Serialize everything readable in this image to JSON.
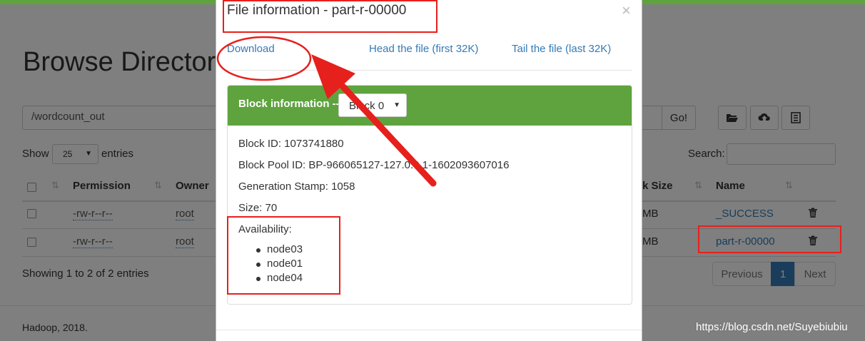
{
  "page": {
    "title": "Browse Director",
    "path_value": "/wordcount_out",
    "go_label": "Go!",
    "show_label": "Show",
    "page_size": "25",
    "entries_label": "entries",
    "search_label": "Search:",
    "columns": [
      "Permission",
      "Owner",
      "k Size",
      "Name"
    ],
    "rows": [
      {
        "permission": "-rw-r--r--",
        "owner": "root",
        "size": "MB",
        "name": "_SUCCESS"
      },
      {
        "permission": "-rw-r--r--",
        "owner": "root",
        "size": "MB",
        "name": "part-r-00000"
      }
    ],
    "showing_text": "Showing 1 to 2 of 2 entries",
    "pagination": {
      "previous": "Previous",
      "current": "1",
      "next": "Next"
    },
    "footer": "Hadoop, 2018.",
    "watermark": "https://blog.csdn.net/Suyebiubiu"
  },
  "modal": {
    "title": "File information - part-r-00000",
    "close": "×",
    "links": {
      "download": "Download",
      "head": "Head the file (first 32K)",
      "tail": "Tail the file (last 32K)"
    },
    "panel": {
      "heading": "Block information --",
      "block_select": "Block 0",
      "block_id": "Block ID: 1073741880",
      "block_pool_id": "Block Pool ID: BP-966065127-127.0.0.1-1602093607016",
      "generation_stamp": "Generation Stamp: 1058",
      "size": "Size: 70",
      "availability_label": "Availability:",
      "availability": [
        "node03",
        "node01",
        "node04"
      ]
    }
  },
  "icons": [
    "folder-open-icon",
    "cloud-upload-icon",
    "list-icon",
    "trash-icon",
    "sort-icon",
    "caret-down-icon"
  ],
  "colors": {
    "brand_green": "#5fa33e",
    "link_blue": "#337ab7",
    "annotation_red": "#e6201c",
    "overlay": "rgba(0,0,0,0.5)"
  }
}
